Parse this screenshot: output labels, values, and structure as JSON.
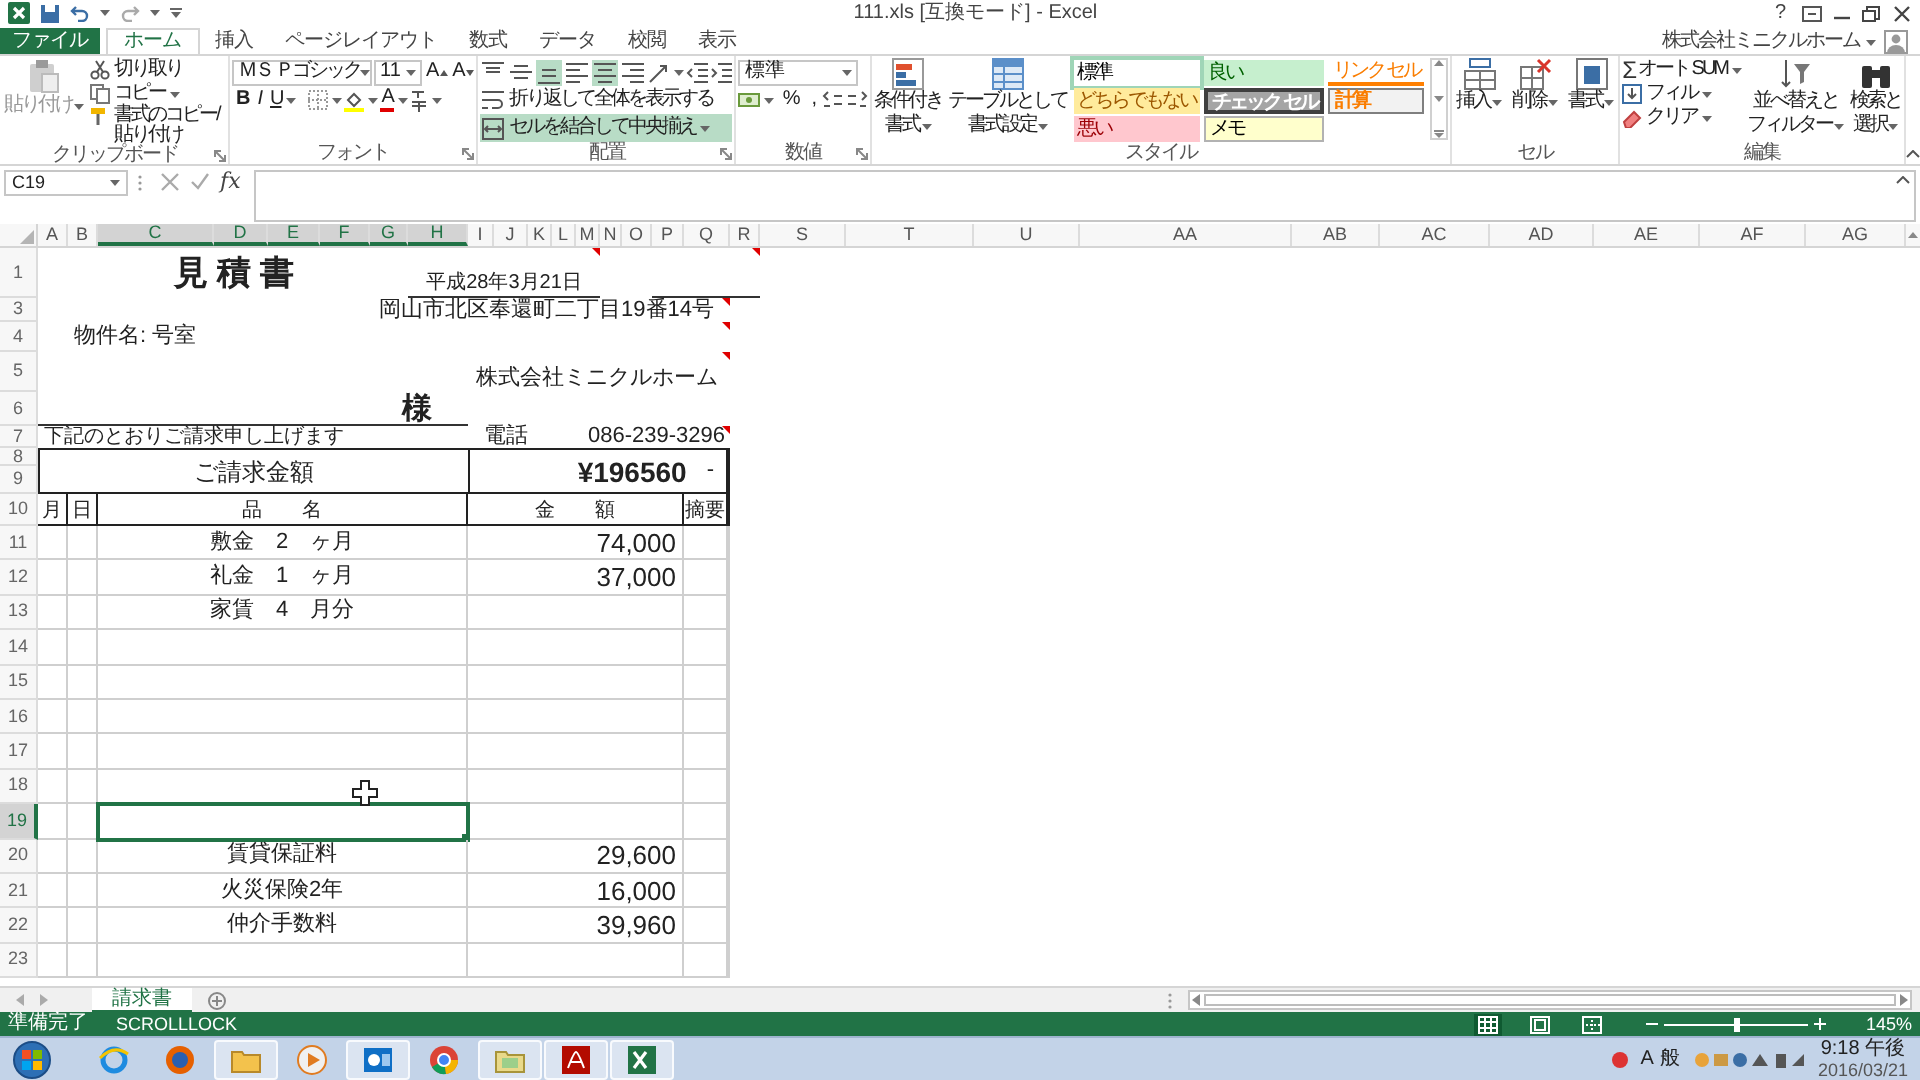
{
  "window": {
    "title": "111.xls [互換モード] - Excel",
    "help": "?",
    "account": "株式会社ミニクルホーム"
  },
  "ribbon_tabs": [
    {
      "label": "ファイル",
      "kind": "file",
      "selected": false
    },
    {
      "label": "ホーム",
      "kind": "tab",
      "selected": true
    },
    {
      "label": "挿入",
      "kind": "tab",
      "selected": false
    },
    {
      "label": "ページレイアウト",
      "kind": "tab",
      "selected": false
    },
    {
      "label": "数式",
      "kind": "tab",
      "selected": false
    },
    {
      "label": "データ",
      "kind": "tab",
      "selected": false
    },
    {
      "label": "校閲",
      "kind": "tab",
      "selected": false
    },
    {
      "label": "表示",
      "kind": "tab",
      "selected": false
    }
  ],
  "clipboard": {
    "label": "クリップボード",
    "paste": {
      "label": "貼り付け",
      "disabled": true
    },
    "cut": "切り取り",
    "copy": "コピー",
    "format_painter": "書式のコピー/貼り付け"
  },
  "font": {
    "label": "フォント",
    "name": "ＭＳ Ｐゴシック",
    "size": "11",
    "grow": "A",
    "shrink": "A",
    "font_color": "A",
    "styles": [
      {
        "label": "B",
        "kind": "bold"
      },
      {
        "label": "I",
        "kind": "italic"
      },
      {
        "label": "U",
        "kind": "underline"
      }
    ]
  },
  "alignment": {
    "label": "配置",
    "vertical": [
      {
        "kind": "top",
        "selected": false
      },
      {
        "kind": "middle",
        "selected": false
      },
      {
        "kind": "bottom",
        "selected": true
      }
    ],
    "horizontal": [
      {
        "kind": "left",
        "selected": false
      },
      {
        "kind": "center",
        "selected": true
      },
      {
        "kind": "right",
        "selected": false
      }
    ],
    "wrap_text": {
      "label": "折り返して全体を表示する",
      "selected": false
    },
    "merge": {
      "label": "セルを結合して中央揃え",
      "selected": true
    }
  },
  "number": {
    "label": "数値",
    "format": "標準",
    "percent": "%",
    "comma": ","
  },
  "styles": {
    "label": "スタイル",
    "conditional": [
      "条件付き",
      "書式"
    ],
    "format_table": [
      "テーブルとして",
      "書式設定"
    ],
    "gallery": [
      {
        "label": "標準",
        "kind": "normal",
        "selected": true
      },
      {
        "label": "どちらでもない",
        "kind": "neutral",
        "selected": false
      },
      {
        "label": "悪い",
        "kind": "bad",
        "selected": false
      },
      {
        "label": "良い",
        "kind": "good",
        "selected": false
      },
      {
        "label": "チェック セル",
        "kind": "check",
        "selected": false
      },
      {
        "label": "メモ",
        "kind": "note",
        "selected": false
      },
      {
        "label": "リンク セル",
        "kind": "linked",
        "selected": false
      },
      {
        "label": "計算",
        "kind": "calculation",
        "selected": false
      }
    ]
  },
  "cells": {
    "label": "セル",
    "buttons": [
      {
        "label": "挿入",
        "kind": "insert"
      },
      {
        "label": "削除",
        "kind": "delete"
      },
      {
        "label": "書式",
        "kind": "format"
      }
    ]
  },
  "editing": {
    "label": "編集",
    "autosum_symbol": "Σ",
    "autosum": "オート SUM",
    "fill": "フィル",
    "clear": "クリア",
    "sort": [
      "並べ替えと",
      "フィルター"
    ],
    "find": [
      "検索と",
      "選択"
    ]
  },
  "formula_bar": {
    "name_box": "C19",
    "fx": "fx"
  },
  "columns": [
    {
      "label": "A",
      "selected": false
    },
    {
      "label": "B",
      "selected": false
    },
    {
      "label": "C",
      "selected": true
    },
    {
      "label": "D",
      "selected": true
    },
    {
      "label": "E",
      "selected": true
    },
    {
      "label": "F",
      "selected": true
    },
    {
      "label": "G",
      "selected": true
    },
    {
      "label": "H",
      "selected": true
    },
    {
      "label": "I",
      "selected": false
    },
    {
      "label": "J",
      "selected": false
    },
    {
      "label": "K",
      "selected": false
    },
    {
      "label": "L",
      "selected": false
    },
    {
      "label": "M",
      "selected": false
    },
    {
      "label": "N",
      "selected": false
    },
    {
      "label": "O",
      "selected": false
    },
    {
      "label": "P",
      "selected": false
    },
    {
      "label": "Q",
      "selected": false
    },
    {
      "label": "R",
      "selected": false
    },
    {
      "label": "S",
      "selected": false
    },
    {
      "label": "T",
      "selected": false
    },
    {
      "label": "U",
      "selected": false
    },
    {
      "label": "AA",
      "selected": false
    },
    {
      "label": "AB",
      "selected": false
    },
    {
      "label": "AC",
      "selected": false
    },
    {
      "label": "AD",
      "selected": false
    },
    {
      "label": "AE",
      "selected": false
    },
    {
      "label": "AF",
      "selected": false
    },
    {
      "label": "AG",
      "selected": false
    }
  ],
  "rows": [
    {
      "label": "1",
      "selected": false
    },
    {
      "label": "3",
      "selected": false
    },
    {
      "label": "4",
      "selected": false
    },
    {
      "label": "5",
      "selected": false
    },
    {
      "label": "6",
      "selected": false
    },
    {
      "label": "7",
      "selected": false
    },
    {
      "label": "8",
      "selected": false
    },
    {
      "label": "9",
      "selected": false
    },
    {
      "label": "10",
      "selected": false
    },
    {
      "label": "11",
      "selected": false
    },
    {
      "label": "12",
      "selected": false
    },
    {
      "label": "13",
      "selected": false
    },
    {
      "label": "14",
      "selected": false
    },
    {
      "label": "15",
      "selected": false
    },
    {
      "label": "16",
      "selected": false
    },
    {
      "label": "17",
      "selected": false
    },
    {
      "label": "18",
      "selected": false
    },
    {
      "label": "19",
      "selected": true
    },
    {
      "label": "20",
      "selected": false
    },
    {
      "label": "21",
      "selected": false
    },
    {
      "label": "22",
      "selected": false
    },
    {
      "label": "23",
      "selected": false
    }
  ],
  "invoice": {
    "title": "見 積 書",
    "date": {
      "text": "平成28年3月21日",
      "comment": true
    },
    "blank_line": {
      "comment": true
    },
    "address": {
      "text": "岡山市北区奉還町二丁目19番14号",
      "comment": true
    },
    "property": {
      "text": "物件名: 号室",
      "comment": true
    },
    "company": {
      "text": "株式会社ミニクルホーム",
      "comment": true
    },
    "honorific": "様",
    "note": "下記のとおりご請求申し上げます",
    "phone_label": "電話",
    "phone": {
      "text": "086-239-3296",
      "comment": true
    },
    "total_label": "ご請求金額",
    "total": "¥196560",
    "total_suffix": "-",
    "headers": [
      "月",
      "日",
      "品　　名",
      "金　　額",
      "摘要"
    ],
    "items": [
      {
        "name": "敷金　2　ヶ月",
        "amount": "74,000",
        "selected": false
      },
      {
        "name": "礼金　1　ヶ月",
        "amount": "37,000",
        "selected": false
      },
      {
        "name": "家賃　4　月分",
        "selected": false
      },
      {
        "selected": false
      },
      {
        "selected": false
      },
      {
        "selected": false
      },
      {
        "selected": false
      },
      {
        "selected": false
      },
      {
        "selected": true
      },
      {
        "name": "賃貸保証料",
        "amount": "29,600",
        "selected": false
      },
      {
        "name": "火災保険2年",
        "amount": "16,000",
        "selected": false
      },
      {
        "name": "仲介手数料",
        "amount": "39,960",
        "selected": false
      },
      {
        "selected": false
      }
    ]
  },
  "sheet_tabs": [
    {
      "label": "請求書",
      "selected": true
    }
  ],
  "status_bar": {
    "ready": "準備完了",
    "scroll_lock": "SCROLLLOCK",
    "views": [
      {
        "kind": "normal",
        "selected": true
      },
      {
        "kind": "page_layout",
        "selected": false
      },
      {
        "kind": "page_break",
        "selected": false
      }
    ],
    "zoom": {
      "level": 0.5
    },
    "zoom_text": "145%"
  },
  "taskbar": {
    "apps": [
      {
        "kind": "ie",
        "running": false
      },
      {
        "kind": "firefox",
        "running": false
      },
      {
        "kind": "explorer",
        "running": true
      },
      {
        "kind": "media",
        "running": false
      },
      {
        "kind": "outlook",
        "running": true
      },
      {
        "kind": "chrome",
        "running": false
      },
      {
        "kind": "folder",
        "running": true
      },
      {
        "kind": "acrobat",
        "running": true
      },
      {
        "kind": "excel",
        "running": true
      }
    ],
    "ime": [
      "A",
      "般"
    ],
    "time": "9:18 午後",
    "date": "2016/03/21"
  }
}
